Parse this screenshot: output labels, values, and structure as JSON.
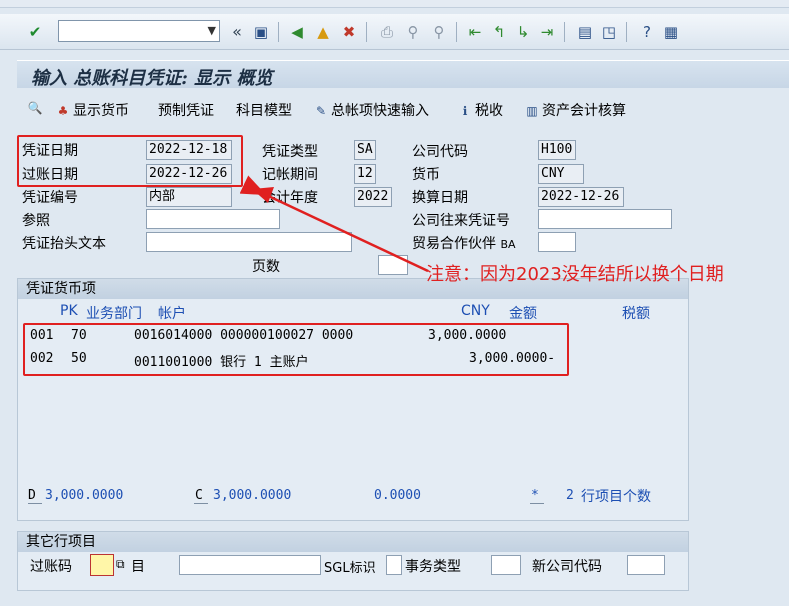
{
  "toolbar": {
    "icons": [
      "enter-icon",
      "save-icon",
      "back-icon",
      "exit-icon",
      "cancel-icon",
      "print-icon",
      "find-icon",
      "find-next-icon",
      "first-page-icon",
      "prev-page-icon",
      "next-page-icon",
      "last-page-icon",
      "create-session-icon",
      "shortcut-icon",
      "help-icon",
      "customize-icon"
    ],
    "back_arrows": "«"
  },
  "window_title": "输入 总账科目凭证: 显示 概览",
  "app_toolbar": {
    "display_currency": "显示货币",
    "park_document": "预制凭证",
    "account_model": "科目模型",
    "gl_fast_entry": "总帐项快速输入",
    "tax": "税收",
    "asset_accounting": "资产会计核算"
  },
  "header": {
    "doc_date_label": "凭证日期",
    "doc_date": "2022-12-18",
    "posting_date_label": "过账日期",
    "posting_date": "2022-12-26",
    "doc_number_label": "凭证编号",
    "doc_number": "内部",
    "reference_label": "参照",
    "reference": "",
    "header_text_label": "凭证抬头文本",
    "header_text": "",
    "doc_type_label": "凭证类型",
    "doc_type": "SA",
    "period_label": "记帐期间",
    "period": "12",
    "fiscal_year_label": "会计年度",
    "fiscal_year": "2022",
    "company_code_label": "公司代码",
    "company_code": "H100",
    "currency_label": "货币",
    "currency": "CNY",
    "translation_date_label": "换算日期",
    "translation_date": "2022-12-26",
    "intercompany_label": "公司往来凭证号",
    "intercompany": "",
    "trading_partner_label": "贸易合作伙伴",
    "trading_partner_suffix": "BA",
    "trading_partner": "",
    "page_label": "页数",
    "page": ""
  },
  "items_group": {
    "title": "凭证货币项",
    "col_pk": "PK",
    "col_bus_area": "业务部门",
    "col_account": "帐户",
    "col_currency": "CNY",
    "col_amount": "金额",
    "col_tax": "税额",
    "rows": [
      {
        "line": "001",
        "pk": "70",
        "account": "0016014000 000000100027 0000",
        "amount": "3,000.0000"
      },
      {
        "line": "002",
        "pk": "50",
        "account": "0011001000 银行 1 主账户",
        "amount": "3,000.0000-"
      }
    ],
    "debit_prefix": "D",
    "debit_total": "3,000.0000",
    "credit_prefix": "C",
    "credit_total": "3,000.0000",
    "balance": "0.0000",
    "star": "*",
    "line_count": "2",
    "line_count_label": "行项目个数"
  },
  "other_group": {
    "title": "其它行项目",
    "posting_key_label": "过账码",
    "account_label": "目",
    "sgl_label": "SGL标识",
    "trans_type_label": "事务类型",
    "new_cc_label": "新公司代码"
  },
  "annotation": {
    "note": "注意：因为2023没年结所以换个日期",
    "color": "#e02020"
  }
}
